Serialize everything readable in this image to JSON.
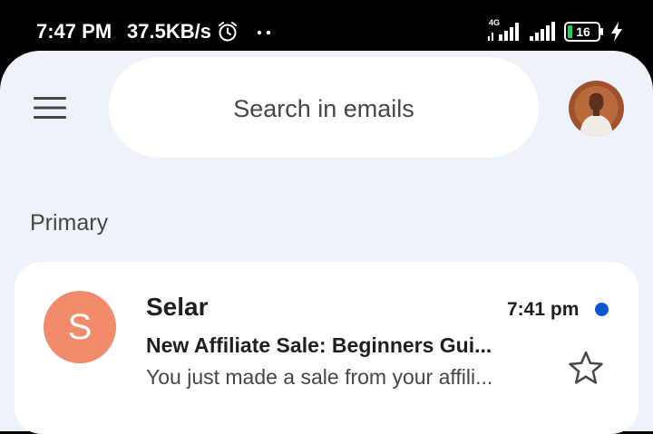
{
  "status_bar": {
    "time": "7:47 PM",
    "speed": "37.5KB/s",
    "network_type": "4G",
    "battery_level": "16",
    "icons": [
      "alarm-icon",
      "notification-dots-icon",
      "signal-icon",
      "signal-icon",
      "battery-icon",
      "charging-icon"
    ]
  },
  "header": {
    "search_placeholder": "Search in emails",
    "icons": [
      "menu-icon",
      "avatar"
    ]
  },
  "section": {
    "label": "Primary"
  },
  "emails": [
    {
      "avatar_letter": "S",
      "avatar_color": "#f28b6c",
      "sender": "Selar",
      "time": "7:41 pm",
      "subject": "New Affiliate Sale: Beginners Gui...",
      "snippet": "You just made a sale from your affili...",
      "unread": true,
      "starred": false
    }
  ],
  "colors": {
    "background": "#eef2f9",
    "card": "#ffffff",
    "unread_dot": "#0b57d0"
  }
}
